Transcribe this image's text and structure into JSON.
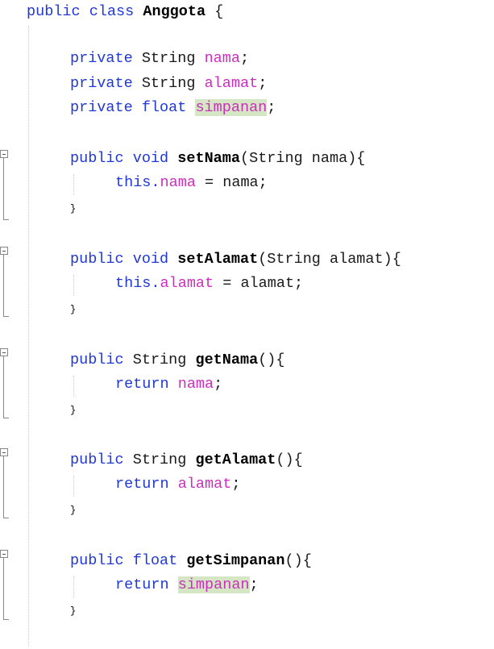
{
  "editor": {
    "language": "Java",
    "class_decl": {
      "modifier": "public",
      "keyword": "class",
      "name": "Anggota",
      "brace": "{"
    },
    "fields": [
      {
        "modifier": "private",
        "type": "String",
        "name": "nama",
        "end": ";",
        "highlighted": false
      },
      {
        "modifier": "private",
        "type": "String",
        "name": "alamat",
        "end": ";",
        "highlighted": false
      },
      {
        "modifier": "private",
        "type": "float",
        "name": "simpanan",
        "end": ";",
        "highlighted": true
      }
    ],
    "methods": [
      {
        "modifier": "public",
        "return_type": "void",
        "name": "setNama",
        "params": "(String nama){",
        "body_prefix": "this.",
        "body_field": "nama",
        "body_suffix": " = nama;",
        "close": "}"
      },
      {
        "modifier": "public",
        "return_type": "void",
        "name": "setAlamat",
        "params": "(String alamat){",
        "body_prefix": "this.",
        "body_field": "alamat",
        "body_suffix": " = alamat;",
        "close": "}"
      },
      {
        "modifier": "public",
        "return_type": "String",
        "name": "getNama",
        "params": "(){",
        "body_prefix": "return ",
        "body_field": "nama",
        "body_suffix": ";",
        "close": "}"
      },
      {
        "modifier": "public",
        "return_type": "String",
        "name": "getAlamat",
        "params": "(){",
        "body_prefix": "return ",
        "body_field": "alamat",
        "body_suffix": ";",
        "close": "}"
      },
      {
        "modifier": "public",
        "return_type": "float",
        "name": "getSimpanan",
        "params": "(){",
        "body_prefix": "return ",
        "body_field": "simpanan",
        "body_suffix": ";",
        "close": "}",
        "field_highlighted": true
      }
    ],
    "colors": {
      "keyword": "#1f38d6",
      "field": "#cc2fbe",
      "highlight": "#d4e6c3",
      "text": "#000000"
    },
    "icons": {
      "fold_marker": "collapse-fold-icon"
    }
  }
}
